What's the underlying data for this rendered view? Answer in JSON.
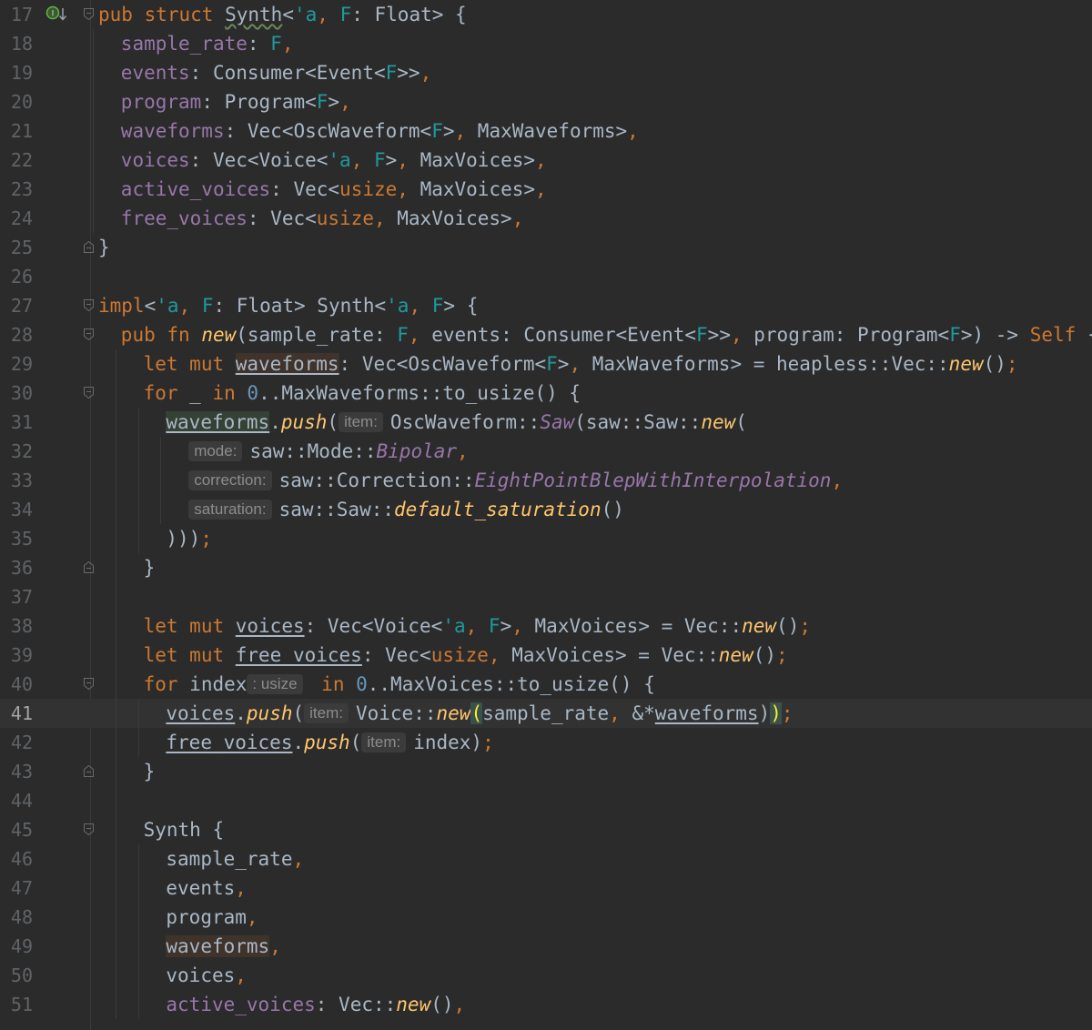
{
  "editor": {
    "current_line": 41,
    "lines": [
      {
        "n": "17"
      },
      {
        "n": "18"
      },
      {
        "n": "19"
      },
      {
        "n": "20"
      },
      {
        "n": "21"
      },
      {
        "n": "22"
      },
      {
        "n": "23"
      },
      {
        "n": "24"
      },
      {
        "n": "25"
      },
      {
        "n": "26"
      },
      {
        "n": "27"
      },
      {
        "n": "28"
      },
      {
        "n": "29"
      },
      {
        "n": "30"
      },
      {
        "n": "31"
      },
      {
        "n": "32"
      },
      {
        "n": "33"
      },
      {
        "n": "34"
      },
      {
        "n": "35"
      },
      {
        "n": "36"
      },
      {
        "n": "37"
      },
      {
        "n": "38"
      },
      {
        "n": "39"
      },
      {
        "n": "40"
      },
      {
        "n": "41"
      },
      {
        "n": "42"
      },
      {
        "n": "43"
      },
      {
        "n": "44"
      },
      {
        "n": "45"
      },
      {
        "n": "46"
      },
      {
        "n": "47"
      },
      {
        "n": "48"
      },
      {
        "n": "49"
      },
      {
        "n": "50"
      },
      {
        "n": "51"
      }
    ],
    "code": {
      "l17": [
        "pub ",
        "struct ",
        "Synth",
        "<",
        "'a",
        ", ",
        "F",
        ": ",
        "Float",
        "> {"
      ],
      "l18": [
        "sample_rate",
        ": ",
        "F",
        ","
      ],
      "l19": [
        "events",
        ": ",
        "Consumer<Event<",
        "F",
        ">>",
        ","
      ],
      "l20": [
        "program",
        ": ",
        "Program<",
        "F",
        ">",
        ","
      ],
      "l21": [
        "waveforms",
        ": ",
        "Vec<OscWaveform<",
        "F",
        ">",
        ", ",
        "MaxWaveforms>",
        ","
      ],
      "l22": [
        "voices",
        ": ",
        "Vec<Voice<",
        "'a",
        ", ",
        "F",
        ">",
        ", ",
        "MaxVoices>",
        ","
      ],
      "l23": [
        "active_voices",
        ": ",
        "Vec<",
        "usize",
        ", ",
        "MaxVoices>",
        ","
      ],
      "l24": [
        "free_voices",
        ": ",
        "Vec<",
        "usize",
        ", ",
        "MaxVoices>",
        ","
      ],
      "l25": [
        "}"
      ],
      "l27": [
        "impl",
        "<",
        "'a",
        ", ",
        "F",
        ": ",
        "Float",
        "> ",
        "Synth<",
        "'a",
        ", ",
        "F",
        "> {"
      ],
      "l28": [
        "pub ",
        "fn ",
        "new",
        "(sample_rate: ",
        "F",
        ", ",
        "events: Consumer<Event<",
        "F",
        ">>",
        ", ",
        "program: Program<",
        "F",
        ">) -> ",
        "Self",
        " {"
      ],
      "l29": [
        "let ",
        "mut ",
        "waveforms",
        ": Vec<OscWaveform<",
        "F",
        ">",
        ", ",
        "MaxWaveforms> = heapless::Vec::",
        "new",
        "()",
        ";"
      ],
      "l30": [
        "for ",
        "_ ",
        "in ",
        "0",
        "..MaxWaveforms::to_usize() {"
      ],
      "l31": [
        "waveforms",
        ".",
        "push",
        "(",
        "item:",
        "OscWaveform::",
        "Saw",
        "(saw::Saw::",
        "new",
        "("
      ],
      "l32": [
        "mode:",
        "saw::Mode::",
        "Bipolar",
        ","
      ],
      "l33": [
        "correction:",
        "saw::Correction::",
        "EightPointBlepWithInterpolation",
        ","
      ],
      "l34": [
        "saturation:",
        "saw::Saw::",
        "default_saturation",
        "()"
      ],
      "l35": [
        ")))",
        ";"
      ],
      "l36": [
        "}"
      ],
      "l38": [
        "let ",
        "mut ",
        "voices",
        ": Vec<Voice<",
        "'a",
        ", ",
        "F",
        ">",
        ", ",
        "MaxVoices> = Vec::",
        "new",
        "()",
        ";"
      ],
      "l39": [
        "let ",
        "mut ",
        "free_voices",
        ": Vec<",
        "usize",
        ", ",
        "MaxVoices> = Vec::",
        "new",
        "()",
        ";"
      ],
      "l40": [
        "for ",
        "index",
        ": usize",
        " in ",
        "0",
        "..MaxVoices::to_usize() {"
      ],
      "l41": [
        "voices",
        ".",
        "push",
        "(",
        "item:",
        "Voice::",
        "new",
        "(",
        "sample_rate",
        ", ",
        "&*",
        "waveforms",
        ")",
        ")",
        ";"
      ],
      "l42": [
        "free_voices",
        ".",
        "push",
        "(",
        "item:",
        "index)",
        ";"
      ],
      "l43": [
        "}"
      ],
      "l45": [
        "Synth {"
      ],
      "l46": [
        "sample_rate",
        ","
      ],
      "l47": [
        "events",
        ","
      ],
      "l48": [
        "program",
        ","
      ],
      "l49": [
        "waveforms",
        ","
      ],
      "l50": [
        "voices",
        ","
      ],
      "l51": [
        "active_voices",
        ": Vec::",
        "new",
        "()",
        ","
      ]
    },
    "gutter_icons": [
      "implemented-marker-icon"
    ]
  }
}
